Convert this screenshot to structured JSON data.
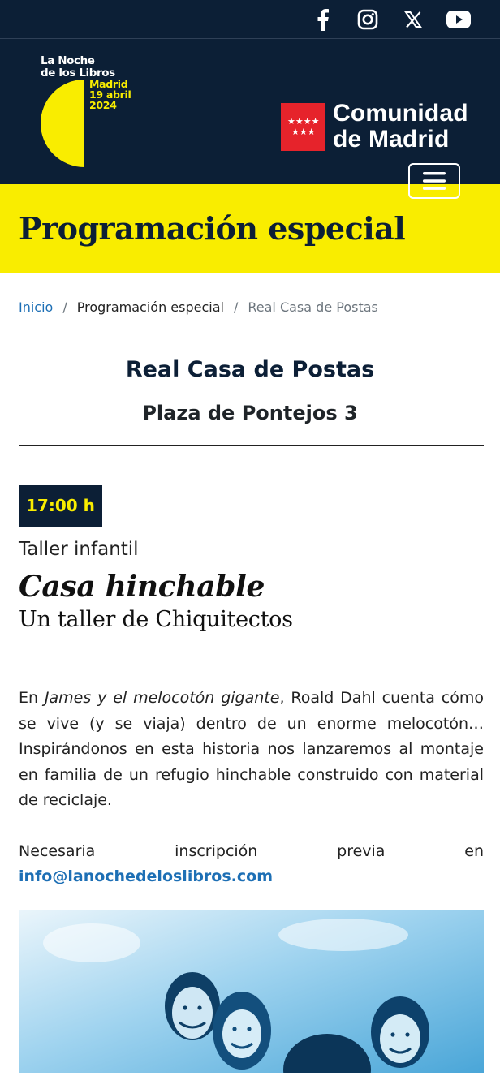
{
  "topbar": {
    "social": [
      {
        "name": "facebook-icon"
      },
      {
        "name": "instagram-icon"
      },
      {
        "name": "x-icon"
      },
      {
        "name": "youtube-icon"
      }
    ]
  },
  "logo_noche": {
    "line1": "La Noche",
    "line2": "de los Libros",
    "date1": "Madrid",
    "date2": "19 abril",
    "date3": "2024"
  },
  "logo_cm": {
    "line1": "Comunidad",
    "line2": "de Madrid"
  },
  "banner": {
    "title": "Programación especial"
  },
  "breadcrumb": {
    "home": "Inicio",
    "section": "Programación especial",
    "current": "Real Casa de Postas",
    "separator": "/"
  },
  "venue": {
    "name": "Real Casa de Postas",
    "address": "Plaza de Pontejos 3"
  },
  "event": {
    "time": "17:00 h",
    "category": "Taller infantil",
    "title": "Casa hinchable",
    "subtitle": "Un taller de Chiquitectos",
    "desc_before": "En ",
    "desc_book": "James y el melocotón gigante",
    "desc_after": ", Roald Dahl cuenta cómo se vive (y se viaja) dentro de un enorme melocotón… Inspirándonos en esta historia nos lanzaremos al montaje en familia de un refugio hinchable construido con material de reciclaje.",
    "reg_words": [
      "Necesaria",
      "inscripción",
      "previa",
      "en"
    ],
    "email": "info@lanochedeloslibros.com"
  },
  "colors": {
    "navy": "#0c1f36",
    "yellow": "#f9ed00",
    "link": "#1d6fb5",
    "flag_red": "#e6232b"
  }
}
